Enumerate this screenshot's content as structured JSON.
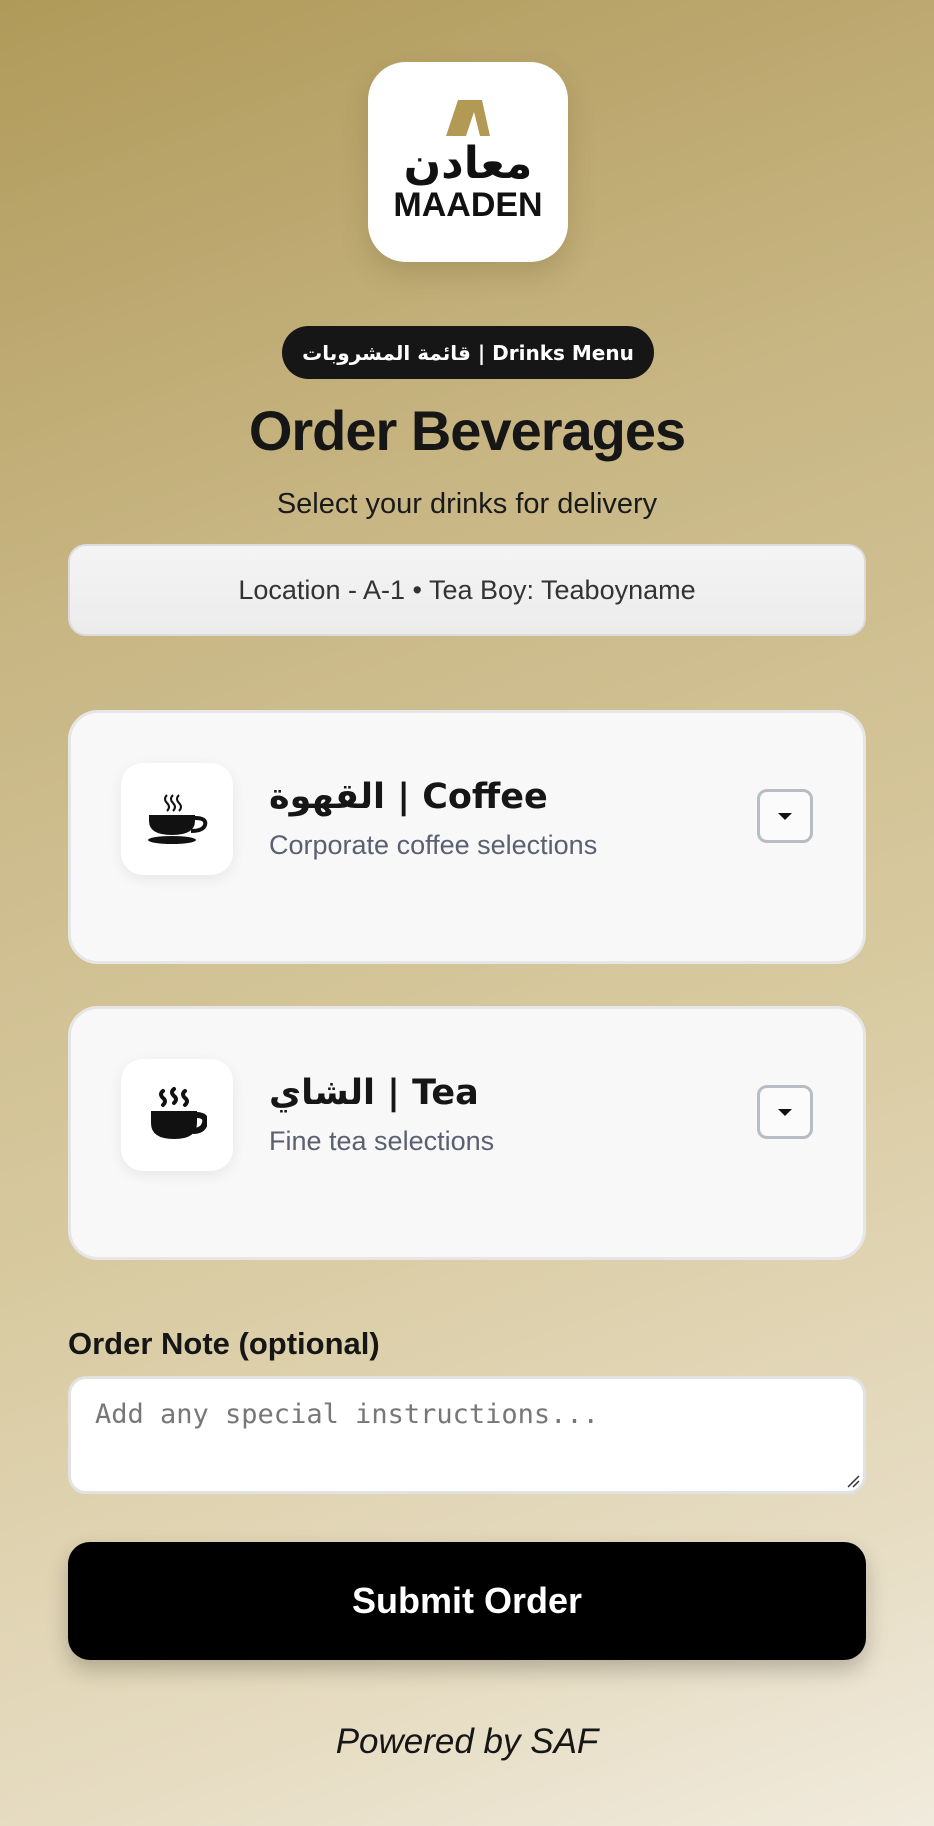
{
  "brand": {
    "logo_arabic": "معادن",
    "logo_latin": "MAADEN",
    "accent_color": "#b29a55"
  },
  "header": {
    "pill_label": "قائمة المشروبات | Drinks Menu",
    "title": "Order Beverages",
    "subtitle": "Select your drinks for delivery"
  },
  "location": {
    "text": "Location - A-1 • Tea Boy: Teaboyname"
  },
  "categories": [
    {
      "title": "القهوة | Coffee",
      "description": "Corporate coffee selections",
      "icon": "coffee-cup-icon",
      "expanded": false
    },
    {
      "title": "الشاي | Tea",
      "description": "Fine tea selections",
      "icon": "tea-cup-icon",
      "expanded": false
    }
  ],
  "note": {
    "label": "Order Note (optional)",
    "placeholder": "Add any special instructions...",
    "value": ""
  },
  "actions": {
    "submit_label": "Submit Order"
  },
  "footer": {
    "powered_by": "Powered by SAF"
  }
}
